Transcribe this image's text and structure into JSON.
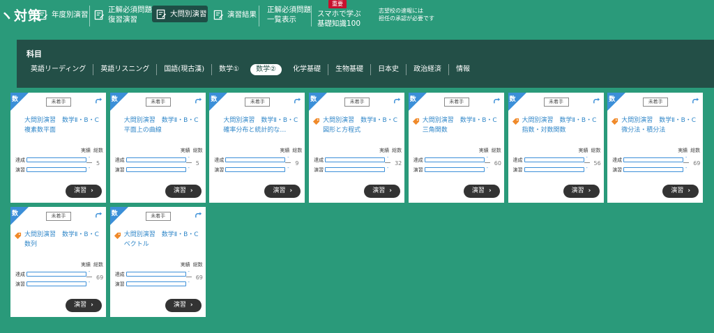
{
  "nav": {
    "brand": "ヽ対策",
    "items": [
      {
        "label1": "年度別演習",
        "label2": ""
      },
      {
        "label1": "正解必須問題",
        "label2": "復習演習"
      },
      {
        "label1": "大問別演習",
        "label2": ""
      },
      {
        "label1": "演習結果",
        "label2": ""
      },
      {
        "label1": "正解必須問題",
        "label2": "一覧表示"
      },
      {
        "label1": "スマホで学ぶ",
        "label2": "基礎知識100"
      }
    ],
    "badge": "重要",
    "note1": "志望校の速報には",
    "note2": "担任の承認が必要です"
  },
  "subjects": {
    "title": "科目",
    "tabs": [
      "英語リーディング",
      "英語リスニング",
      "国語(現古漢)",
      "数学①",
      "数学②",
      "化学基礎",
      "生物基礎",
      "日本史",
      "政治経済",
      "情報"
    ],
    "active_index": 4
  },
  "card_labels": {
    "corner": "数",
    "status": "未着手",
    "achieve": "達成",
    "practice": "演習",
    "result": "実績",
    "total_head": "総数",
    "dash": "-",
    "button": "演習"
  },
  "cards": [
    {
      "title": "大問別演習　数学Ⅱ・B・C　複素数平面",
      "total": "5",
      "tag": false
    },
    {
      "title": "大問別演習　数学Ⅱ・B・C　平面上の曲線",
      "total": "5",
      "tag": false
    },
    {
      "title": "大問別演習　数学Ⅱ・B・C　確率分布と統計的な…",
      "total": "9",
      "tag": false
    },
    {
      "title": "大問別演習　数学Ⅱ・B・C　図形と方程式",
      "total": "32",
      "tag": true
    },
    {
      "title": "大問別演習　数学Ⅱ・B・C　三角関数",
      "total": "60",
      "tag": true
    },
    {
      "title": "大問別演習　数学Ⅱ・B・C　指数・対数関数",
      "total": "56",
      "tag": true
    },
    {
      "title": "大問別演習　数学Ⅱ・B・C　微分法・積分法",
      "total": "69",
      "tag": true
    },
    {
      "title": "大問別演習　数学Ⅱ・B・C　数列",
      "total": "69",
      "tag": true
    },
    {
      "title": "大問別演習　数学Ⅱ・B・C　ベクトル",
      "total": "69",
      "tag": true
    }
  ],
  "colors": {
    "background": "#2a9a7a",
    "panel": "#234f47",
    "accent": "#3b8fd8",
    "badge": "#c8102e"
  },
  "icons": {
    "nav": "edit-note-icon",
    "refresh": "redo-arrow-icon",
    "tag": "tag-icon",
    "button": "chevron-right-icon"
  }
}
